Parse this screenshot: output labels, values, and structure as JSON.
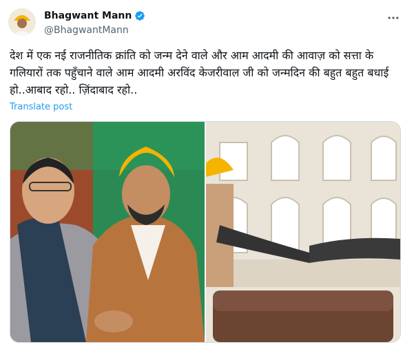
{
  "author": {
    "display_name": "Bhagwant Mann",
    "handle": "@BhagwantMann"
  },
  "tweet": {
    "text": "देश में एक नई राजनीतिक क्रांति को जन्म देने वाले और आम आदमी की आवाज़ को सत्ता के गलियारों तक पहुँचाने वाले आम आदमी अरविंद केजरीवाल जी को जन्मदिन की बहुत बहुत बधाई हो..आबाद रहो.. ज़िंदाबाद रहो..",
    "translate_label": "Translate post"
  },
  "icons": {
    "more": "more-icon",
    "verified": "verified-badge-icon"
  },
  "colors": {
    "link": "#1d9bf0",
    "secondary_text": "#536471",
    "verified": "#1d9bf0"
  }
}
